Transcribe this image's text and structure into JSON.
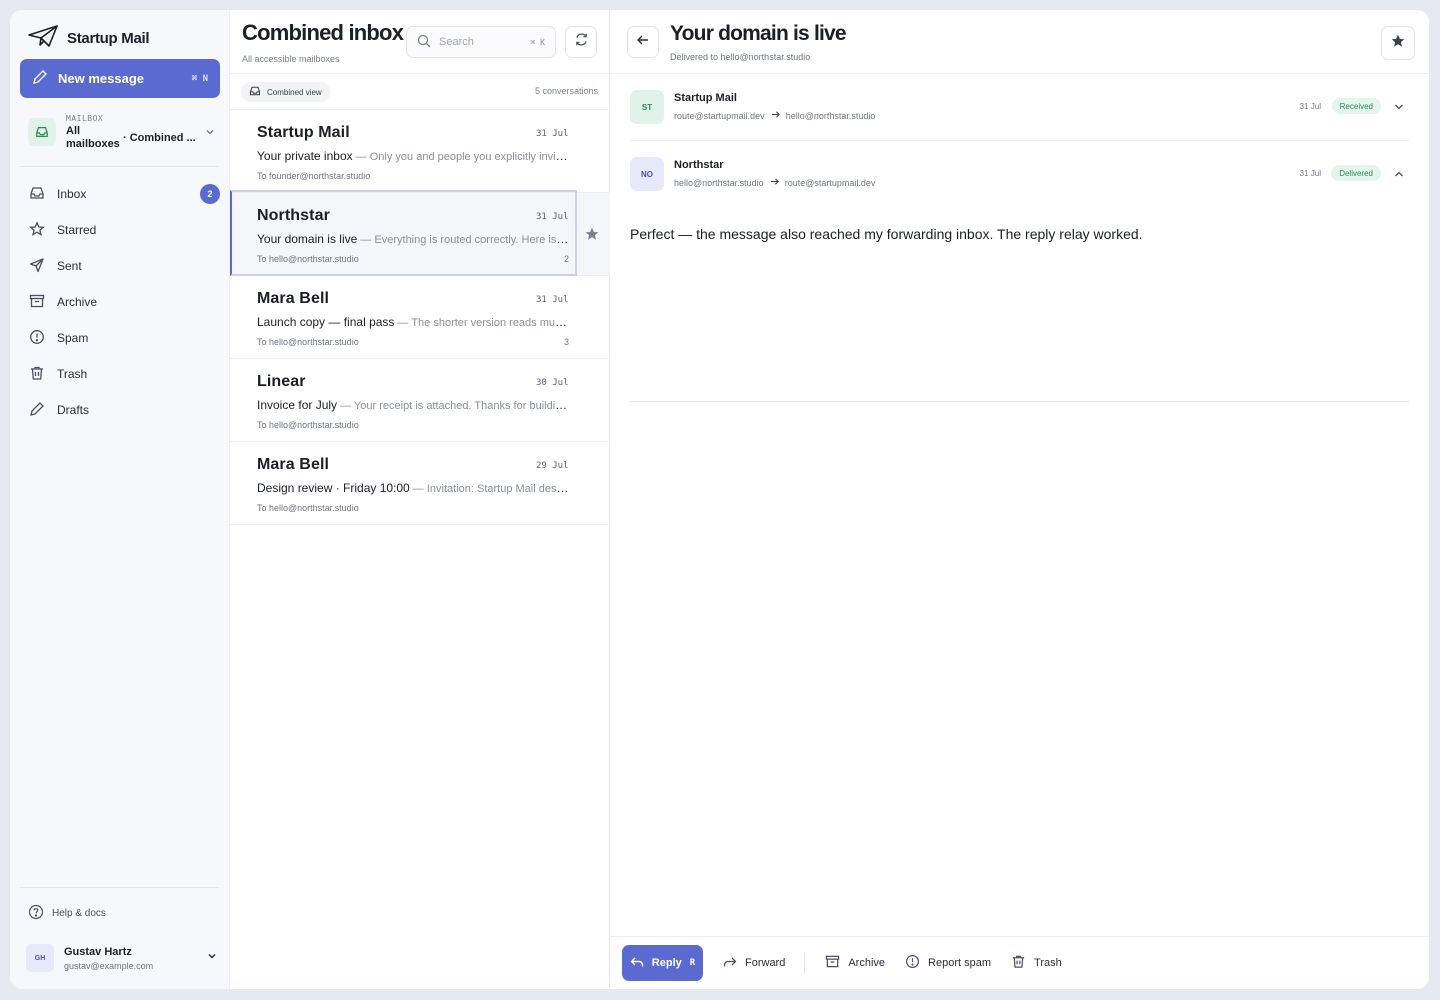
{
  "brand": {
    "name": "Startup Mail"
  },
  "compose": {
    "label": "New message",
    "shortcut": "⌘ N"
  },
  "mailbox": {
    "label": "MAILBOX",
    "name": "All mailboxes",
    "view": "· Combined ..."
  },
  "nav": [
    {
      "label": "Inbox",
      "icon": "inbox-icon",
      "badge": "2"
    },
    {
      "label": "Starred",
      "icon": "star-icon"
    },
    {
      "label": "Sent",
      "icon": "send-icon"
    },
    {
      "label": "Archive",
      "icon": "archive-icon"
    },
    {
      "label": "Spam",
      "icon": "spam-icon"
    },
    {
      "label": "Trash",
      "icon": "trash-icon"
    },
    {
      "label": "Drafts",
      "icon": "pencil-icon"
    }
  ],
  "help": {
    "label": "Help & docs"
  },
  "user": {
    "initials": "GH",
    "name": "Gustav Hartz",
    "email": "gustav@example.com"
  },
  "list": {
    "title": "Combined inbox",
    "subtitle": "All accessible mailboxes",
    "search_placeholder": "Search",
    "search_shortcut": "⌘ K",
    "view_chip": "Combined view",
    "count": "5 conversations",
    "rows": [
      {
        "sender": "Startup Mail",
        "date": "31 Jul",
        "subject": "Your private inbox",
        "snippet": " — Only you and people you explicitly invite can see it.",
        "to": "To founder@northstar.studio",
        "count": ""
      },
      {
        "sender": "Northstar",
        "date": "31 Jul",
        "subject": "Your domain is live",
        "snippet": " — Everything is routed correctly. Here is the summary.",
        "to": "To hello@northstar.studio",
        "count": "2"
      },
      {
        "sender": "Mara Bell",
        "date": "31 Jul",
        "subject": "Launch copy — final pass",
        "snippet": " — The shorter version reads much better, ship it.",
        "to": "To hello@northstar.studio",
        "count": "3"
      },
      {
        "sender": "Linear",
        "date": "30 Jul",
        "subject": "Invoice for July",
        "snippet": " — Your receipt is attached. Thanks for building with us.",
        "to": "To hello@northstar.studio",
        "count": ""
      },
      {
        "sender": "Mara Bell",
        "date": "29 Jul",
        "subject": "Design review · Friday 10:00",
        "snippet": " — Invitation: Startup Mail design review",
        "to": "To hello@northstar.studio",
        "count": ""
      }
    ]
  },
  "detail": {
    "title": "Your domain is live",
    "subtitle": "Delivered to hello@northstar.studio",
    "messages": [
      {
        "initials": "ST",
        "from": "Startup Mail",
        "route_from": "route@startupmail.dev",
        "route_to": "hello@northstar.studio",
        "date": "31 Jul",
        "status": "Received"
      },
      {
        "initials": "NO",
        "from": "Northstar",
        "route_from": "hello@northstar.studio",
        "route_to": "route@startupmail.dev",
        "date": "31 Jul",
        "status": "Delivered"
      }
    ],
    "body": "Perfect — the message also reached my forwarding inbox. The reply relay worked."
  },
  "actions": {
    "reply": "Reply",
    "reply_shortcut": "R",
    "forward": "Forward",
    "archive": "Archive",
    "spam": "Report spam",
    "trash": "Trash"
  },
  "colors": {
    "accent": "#5b6ad0",
    "success_bg": "#e3f5ec",
    "success_text": "#2f8a5b"
  }
}
